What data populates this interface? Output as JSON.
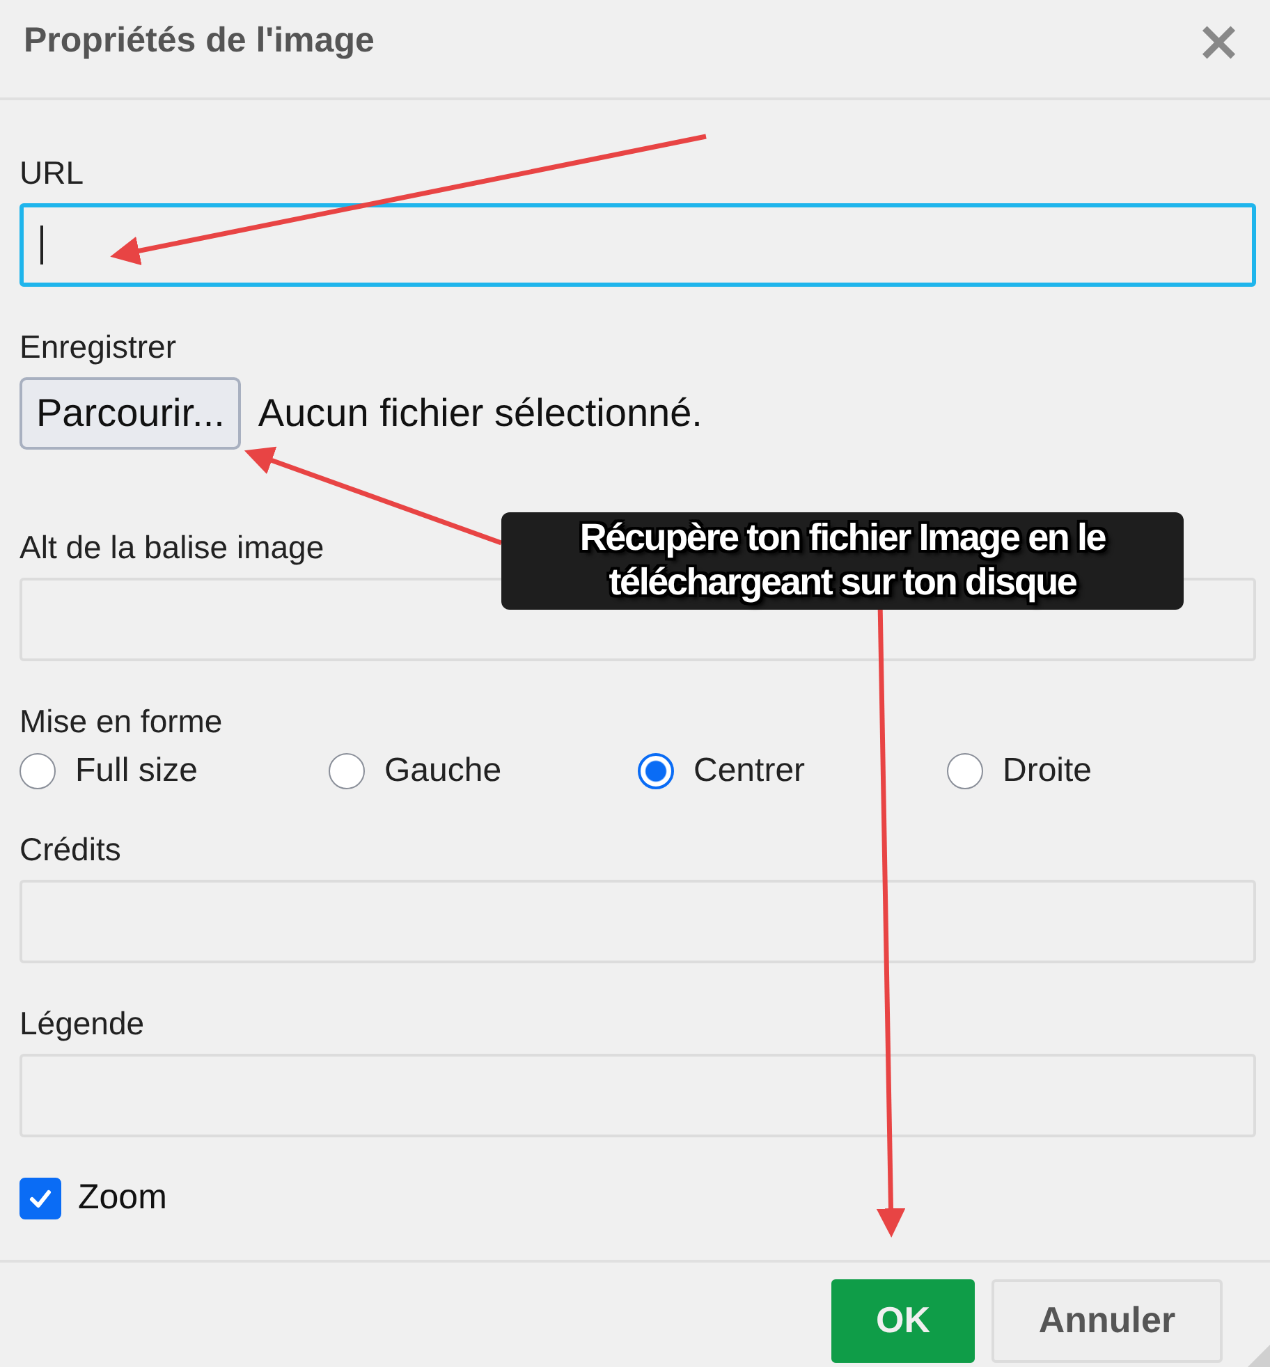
{
  "window": {
    "title": "Propriétés de l'image",
    "close": "×"
  },
  "fields": [
    {
      "kind": "text",
      "label": "URL",
      "focused": true
    },
    {
      "kind": "file",
      "label": "Enregistrer",
      "button": "Parcourir...",
      "status": "Aucun fichier sélectionné."
    },
    {
      "kind": "text",
      "label": "Alt de la balise image",
      "focused": false
    },
    {
      "kind": "radio",
      "label": "Mise en forme",
      "options": [
        {
          "label": "Full size",
          "selected": false
        },
        {
          "label": "Gauche",
          "selected": false
        },
        {
          "label": "Centrer",
          "selected": true
        },
        {
          "label": "Droite",
          "selected": false
        }
      ]
    },
    {
      "kind": "text",
      "label": "Crédits",
      "focused": false
    },
    {
      "kind": "text",
      "label": "Légende",
      "focused": false
    },
    {
      "kind": "checkbox",
      "label": "Zoom",
      "checked": true
    }
  ],
  "buttons": [
    {
      "label": "OK",
      "kind": "primary"
    },
    {
      "label": "Annuler",
      "kind": "secondary"
    }
  ],
  "annotation": {
    "text": "Récupère ton fichier Image en le téléchargeant sur ton disque"
  }
}
